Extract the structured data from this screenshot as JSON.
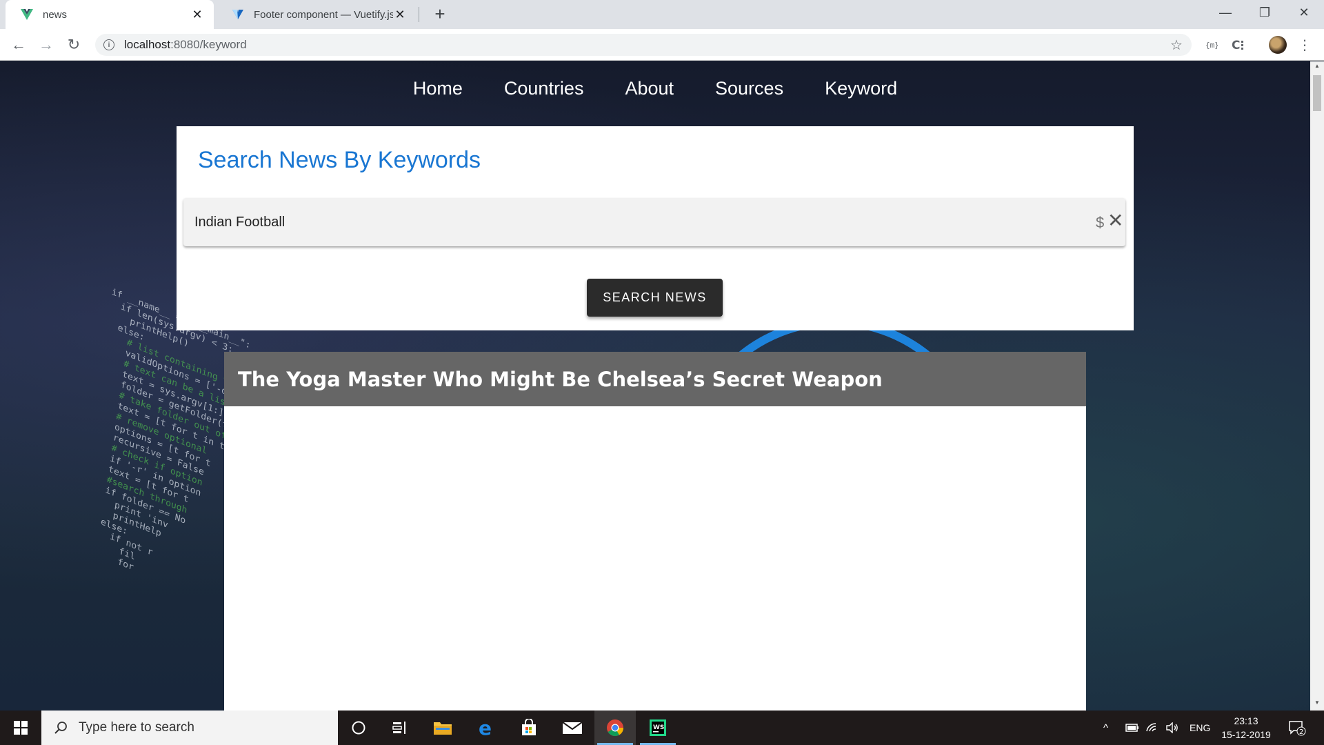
{
  "browser": {
    "tabs": [
      {
        "title": "news",
        "active": true,
        "favicon": "vue-logo-icon"
      },
      {
        "title": "Footer component — Vuetify.js",
        "active": false,
        "favicon": "vuetify-logo-icon"
      }
    ],
    "new_tab": "+",
    "window_controls": {
      "minimize": "—",
      "maximize": "❐",
      "close": "✕"
    },
    "address": {
      "host": "localhost",
      "path": ":8080/keyword"
    },
    "nav": {
      "back": "←",
      "forward": "→",
      "reload": "↻"
    }
  },
  "page": {
    "nav": [
      {
        "label": "Home"
      },
      {
        "label": "Countries"
      },
      {
        "label": "About"
      },
      {
        "label": "Sources"
      },
      {
        "label": "Keyword"
      }
    ],
    "search": {
      "heading": "Search News By Keywords",
      "input_value": "Indian Football",
      "dollar": "$",
      "clear": "✕",
      "button": "SEARCH NEWS"
    },
    "article": {
      "title": "The Yoga Master Who Might Be Chelsea’s Secret Weapon"
    }
  },
  "taskbar": {
    "search_placeholder": "Type here to search",
    "language": "ENG",
    "time": "23:13",
    "date": "15-12-2019",
    "notification_count": "2"
  },
  "colors": {
    "heading_blue": "#1976d2",
    "button_dark": "#2b2b2b",
    "article_titlebar": "#666666"
  }
}
